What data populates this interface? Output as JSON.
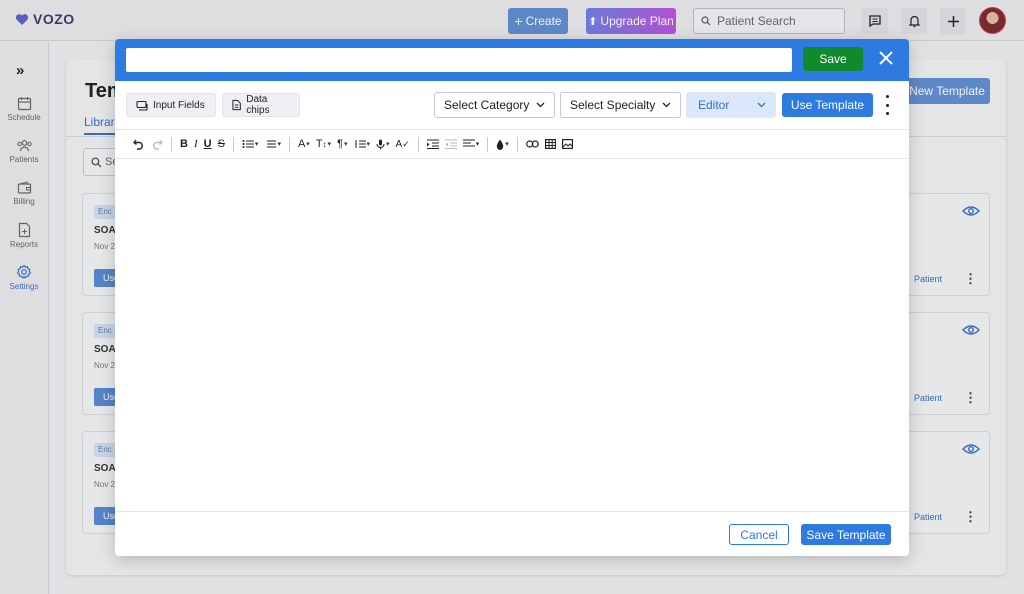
{
  "app": {
    "logo_text": "VOZO",
    "brand_color": "#3a3d66"
  },
  "topbar": {
    "create_label": "Create",
    "upgrade_label": "Upgrade Plan",
    "search_placeholder": "Patient Search"
  },
  "sidebar": {
    "items": [
      {
        "label": "Schedule",
        "icon": "calendar-icon"
      },
      {
        "label": "Patients",
        "icon": "patients-icon"
      },
      {
        "label": "Billing",
        "icon": "wallet-icon"
      },
      {
        "label": "Reports",
        "icon": "report-icon"
      },
      {
        "label": "Settings",
        "icon": "gear-icon",
        "active": true
      }
    ]
  },
  "background_page": {
    "title": "Tem",
    "tab": "Librar",
    "search_placeholder": "Se",
    "new_template_label": "New Template",
    "cards": [
      {
        "chip": "Enc",
        "name": "SOA",
        "date": "Nov 2",
        "use": "Use",
        "patient": "Patient"
      },
      {
        "chip": "Enc",
        "name": "SOA",
        "date": "Nov 2",
        "use": "Use",
        "patient": "Patient"
      },
      {
        "chip": "Enc",
        "name": "SOA",
        "date": "Nov 2",
        "use": "Use",
        "patient": "Patient"
      }
    ]
  },
  "modal": {
    "title_value": "",
    "save_label": "Save",
    "input_fields_label": "Input Fields",
    "data_chips_label": "Data chips",
    "category_select": "Select Category",
    "specialty_select": "Select Specialty",
    "mode_select": "Editor",
    "use_template_label": "Use Template",
    "cancel_label": "Cancel",
    "save_template_label": "Save Template",
    "colors": {
      "primary": "#2d7ae0",
      "save_green": "#118a2e"
    }
  }
}
